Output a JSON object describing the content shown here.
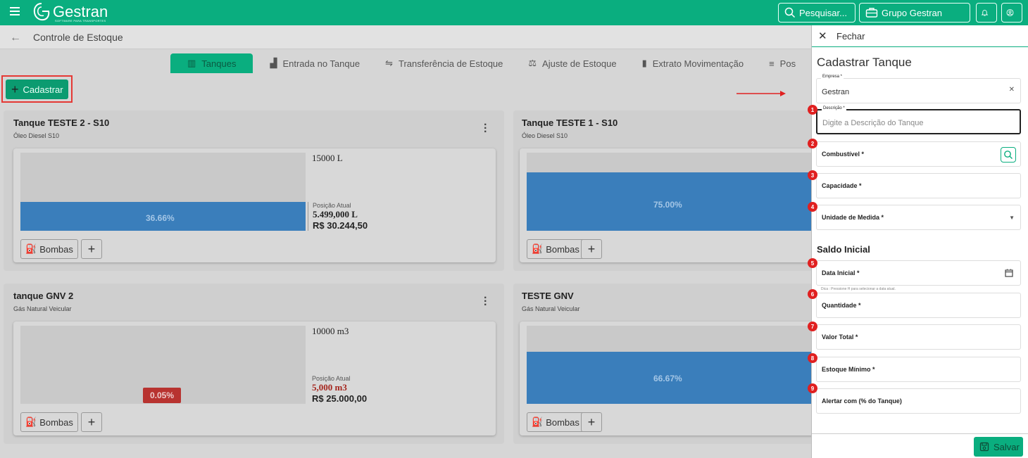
{
  "topbar": {
    "brand": "Gestran",
    "brand_sub": "SOFTWARE PARA TRANSPORTES",
    "search_label": "Pesquisar...",
    "group_label": "Grupo Gestran"
  },
  "subheader": {
    "title": "Controle de Estoque"
  },
  "tabs": [
    {
      "label": "Tanques",
      "icon": "grid-icon"
    },
    {
      "label": "Entrada no Tanque",
      "icon": "bar-chart-icon"
    },
    {
      "label": "Transferência de Estoque",
      "icon": "truck-transfer-icon"
    },
    {
      "label": "Ajuste de Estoque",
      "icon": "adjust-icon"
    },
    {
      "label": "Extrato Movimentação",
      "icon": "document-icon"
    },
    {
      "label": "Pos",
      "icon": "list-icon"
    }
  ],
  "cadastrar_label": "Cadastrar",
  "cards": [
    {
      "title": "Tanque TESTE 2 - S10",
      "fuel": "Óleo Diesel S10",
      "capacity": "15000 L",
      "fill_percent": 36.66,
      "percent_label": "36.66%",
      "position_label": "Posição Atual",
      "position": "5.499,000 L",
      "value": "R$ 30.244,50",
      "bombas": "Bombas"
    },
    {
      "title": "Tanque TESTE 1 - S10",
      "fuel": "Óleo Diesel S10",
      "fill_percent": 75.0,
      "percent_label": "75.00%",
      "bombas": "Bombas"
    },
    {
      "title": "tanque GNV 2",
      "fuel": "Gás Natural Veicular",
      "capacity": "10000 m3",
      "fill_percent": 0.05,
      "percent_label": "0.05%",
      "position_label": "Posição Atual",
      "position": "5,000 m3",
      "value": "R$ 25.000,00",
      "bombas": "Bombas"
    },
    {
      "title": "TESTE GNV",
      "fuel": "Gás Natural Veicular",
      "fill_percent": 66.67,
      "percent_label": "66.67%",
      "bombas": "Bombas"
    }
  ],
  "panel": {
    "close_label": "Fechar",
    "title": "Cadastrar Tanque",
    "empresa_label": "Empresa *",
    "empresa_value": "Gestran",
    "descricao_label": "Descrição *",
    "descricao_placeholder": "Digite a Descrição do Tanque",
    "combustivel_label": "Combustível *",
    "capacidade_label": "Capacidade *",
    "unidade_label": "Unidade de Medida *",
    "saldo_title": "Saldo Inicial",
    "data_label": "Data Inicial *",
    "hint": "Dica : Pressione H para selecionar a data atual.",
    "quantidade_label": "Quantidade *",
    "valor_label": "Valor Total *",
    "estoque_label": "Estoque Mínimo *",
    "alertar_label": "Alertar com (% do Tanque)",
    "save_label": "Salvar",
    "badges": [
      "1",
      "2",
      "3",
      "4",
      "5",
      "6",
      "7",
      "8",
      "9"
    ]
  }
}
